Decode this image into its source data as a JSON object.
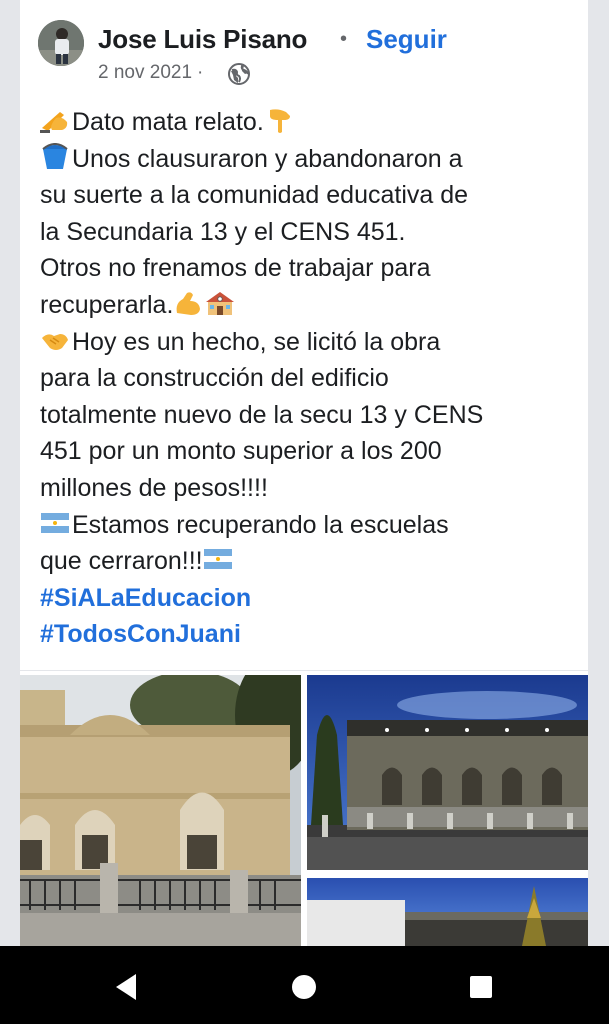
{
  "post": {
    "author": "Jose Luis Pisano",
    "separator": "•",
    "follow_label": "Seguir",
    "date": "2 nov 2021",
    "meta_separator": "·",
    "privacy_icon": "globe-icon",
    "lines": [
      {
        "emoji": "writing-hand-emoji",
        "text": "Dato mata relato.",
        "emoji_after": "pointing-down-emoji"
      },
      {
        "emoji": "bucket-emoji",
        "text": "Unos clausuraron y abandonaron a"
      },
      {
        "text": "su suerte a la comunidad educativa de"
      },
      {
        "text": "la Secundaria 13 y el CENS 451."
      },
      {
        "text": "Otros no frenamos de trabajar para"
      },
      {
        "text": "recuperarla.",
        "emoji_after": "flexed-biceps-emoji",
        "emoji_after2": "school-emoji"
      },
      {
        "emoji": "handshake-emoji",
        "text": "Hoy es un hecho, se licitó la obra"
      },
      {
        "text": "para la construcción del edificio"
      },
      {
        "text": "totalmente nuevo de la secu 13 y CENS"
      },
      {
        "text": "451 por un monto superior a los 200"
      },
      {
        "text": "millones de pesos!!!!"
      },
      {
        "emoji": "argentina-flag-emoji",
        "text": "Estamos recuperando la escuelas"
      },
      {
        "text": "que cerraron!!!",
        "emoji_after": "argentina-flag-emoji"
      }
    ],
    "hashtags": [
      "#SiALaEducacion",
      "#TodosConJuani"
    ]
  },
  "photos": [
    {
      "name": "photo-old-school-building",
      "description_icon": "old-building"
    },
    {
      "name": "photo-new-building-render",
      "description_icon": "render-building"
    },
    {
      "name": "photo-render-second-view",
      "description_icon": "render-building-2"
    }
  ],
  "navigation": {
    "back_icon": "back-triangle-icon",
    "home_icon": "home-circle-icon",
    "recents_icon": "recents-square-icon"
  },
  "colors": {
    "link": "#216fdb",
    "text": "#1c1e21",
    "secondary": "#65676b",
    "background": "#e4e6ea"
  }
}
